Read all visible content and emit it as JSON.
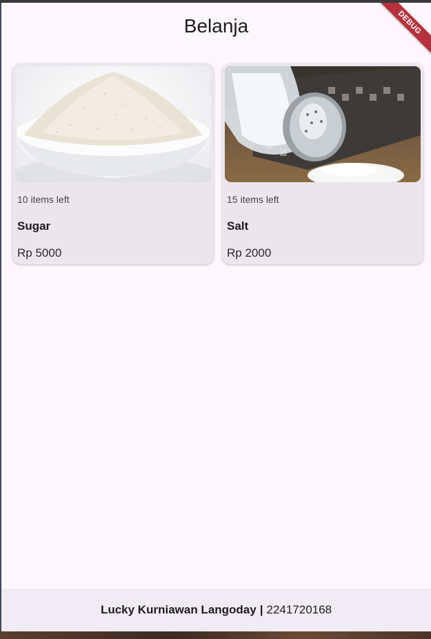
{
  "appbar": {
    "title": "Belanja"
  },
  "debug_banner": {
    "label": "DEBUG"
  },
  "products": [
    {
      "stock_label": "10 items left",
      "name": "Sugar",
      "price": "Rp 5000",
      "image": "sugar-bowl-image"
    },
    {
      "stock_label": "15 items left",
      "name": "Salt",
      "price": "Rp 2000",
      "image": "salt-shaker-image"
    }
  ],
  "footer": {
    "name": "Lucky Kurniawan Langoday",
    "separator": "|",
    "id": "2241720168"
  },
  "colors": {
    "background": "#fdf7fd",
    "card": "#eae6ec",
    "footer": "#f1ecf4",
    "debug": "#b5323d"
  }
}
